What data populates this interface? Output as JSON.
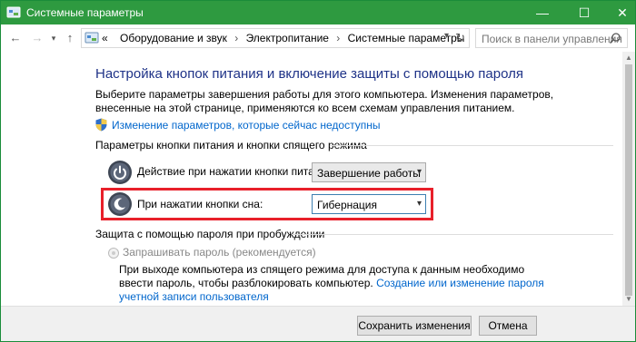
{
  "window": {
    "title": "Системные параметры",
    "controls": {
      "minimize": "—",
      "maximize": "☐",
      "close": "✕"
    }
  },
  "nav": {
    "back": "←",
    "forward": "→",
    "up": "↑",
    "address_prefix": "«",
    "breadcrumbs": [
      "Оборудование и звук",
      "Электропитание",
      "Системные параметры"
    ],
    "separator": "›",
    "search_placeholder": "Поиск в панели управления"
  },
  "main": {
    "heading": "Настройка кнопок питания и включение защиты с помощью пароля",
    "description": "Выберите параметры завершения работы для этого компьютера. Изменения параметров, внесенные на этой странице, применяются ко всем схемам управления питанием.",
    "change_link": "Изменение параметров, которые сейчас недоступны",
    "power_section": {
      "title": "Параметры кнопки питания и кнопки спящего режима",
      "rows": [
        {
          "label": "Действие при нажатии кнопки питания:",
          "value": "Завершение работы"
        },
        {
          "label": "При нажатии кнопки сна:",
          "value": "Гибернация"
        }
      ]
    },
    "password_section": {
      "title": "Защита с помощью пароля при пробуждении",
      "radio_label": "Запрашивать пароль (рекомендуется)",
      "note_text": "При выходе компьютера из спящего режима для доступа к данным необходимо ввести пароль, чтобы разблокировать компьютер. ",
      "note_link": "Создание или изменение пароля учетной записи пользователя"
    }
  },
  "footer": {
    "save_label": "Сохранить изменения",
    "cancel_label": "Отмена"
  },
  "colors": {
    "titlebar": "#2e9a40",
    "heading": "#1e3287",
    "link": "#0066cc",
    "highlight": "#e8202a"
  },
  "icons": {
    "app": "control-panel-icon",
    "shield": "uac-shield-icon",
    "power": "power-button-icon",
    "sleep": "sleep-button-icon",
    "search": "search-icon",
    "refresh": "refresh-icon"
  }
}
